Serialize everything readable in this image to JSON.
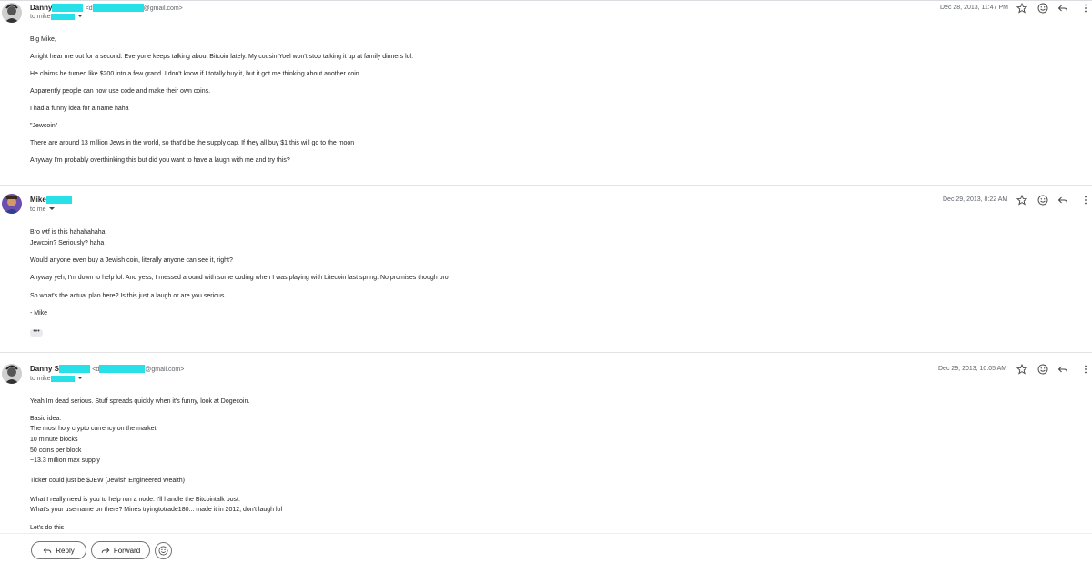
{
  "messages": [
    {
      "sender": "Danny",
      "email_prefix": "<d",
      "email_suffix": "@gmail.com>",
      "to_label": "to mike",
      "date": "Dec 28, 2013, 11:47 PM",
      "body": [
        "Big Mike,",
        "Alright hear me out for a second. Everyone keeps talking about Bitcoin lately. My cousin Yoel won't stop talking it up at family dinners lol.",
        "He claims he turned like $200 into a few grand. I don't know if I totally buy it, but it got me thinking about another coin.",
        "Apparently people can now use code and make their own coins.",
        "I had a funny idea for a name haha",
        "\"Jewcoin\"",
        "There are around 13 million Jews in the world, so that'd be the supply cap. If they all buy $1 this will go to the moon",
        "Anyway I'm probably overthinking this but did you want to have a laugh with me and try this?"
      ]
    },
    {
      "sender": "Mike",
      "to_label": "to me",
      "date": "Dec 29, 2013, 8:22 AM",
      "body": [
        "Bro wtf is this hahahahaha.",
        "Jewcoin? Seriously? haha",
        "Would anyone even buy a Jewish coin, literally anyone can see it, right?",
        "Anyway yeh, I'm down to help lol. And yess, I messed around with some coding when I was playing with Litecoin last spring. No promises though bro",
        "So what's the actual plan here? Is this just a laugh or are you serious",
        "- Mike"
      ],
      "ellipsis": "•••"
    },
    {
      "sender": "Danny S",
      "email_prefix": "<d",
      "email_suffix": "@gmail.com>",
      "to_label": "to mike",
      "date": "Dec 29, 2013, 10:05 AM",
      "body": [
        "Yeah Im dead serious. Stuff spreads quickly when it's funny, look at Dogecoin.",
        "Basic idea:",
        "The most holy crypto currency on the market!",
        "10 minute blocks",
        "50 coins per block",
        "~13.3 million max supply",
        "Ticker could just be $JEW (Jewish Engineered Wealth)",
        "What I really need is you to help run a node. I'll handle the Bitcointalk post.",
        "What's your username on there? Mines tryingtotrade180... made it in 2012, don't laugh lol",
        "Let's do this"
      ]
    }
  ],
  "actions": {
    "reply_label": "Reply",
    "forward_label": "Forward"
  },
  "icons": [
    "star-icon",
    "emoji-icon",
    "reply-icon",
    "more-vert-icon",
    "forward-icon"
  ],
  "colors": {
    "redaction": "#27e0e8",
    "secondary_text": "#5f6368",
    "divider": "#e3e3e3"
  }
}
